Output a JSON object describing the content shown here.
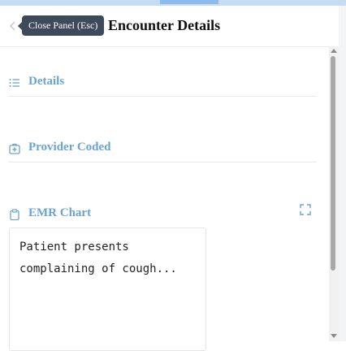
{
  "header": {
    "title": "Encounter Details",
    "close_tooltip": "Close Panel (Esc)"
  },
  "sections": {
    "details": {
      "label": "Details",
      "icon": "list-icon"
    },
    "provider_coded": {
      "label": "Provider Coded",
      "icon": "medical-kit-icon"
    },
    "emr_chart": {
      "label": "EMR Chart",
      "icon": "clipboard-icon",
      "expand_icon": "expand-icon"
    }
  },
  "emr_chart": {
    "text": "Patient presents complaining of cough..."
  },
  "colors": {
    "accent": "#6aa3d4",
    "tooltip_bg": "#3d4a59",
    "top_strip": "#c6dcf2"
  }
}
